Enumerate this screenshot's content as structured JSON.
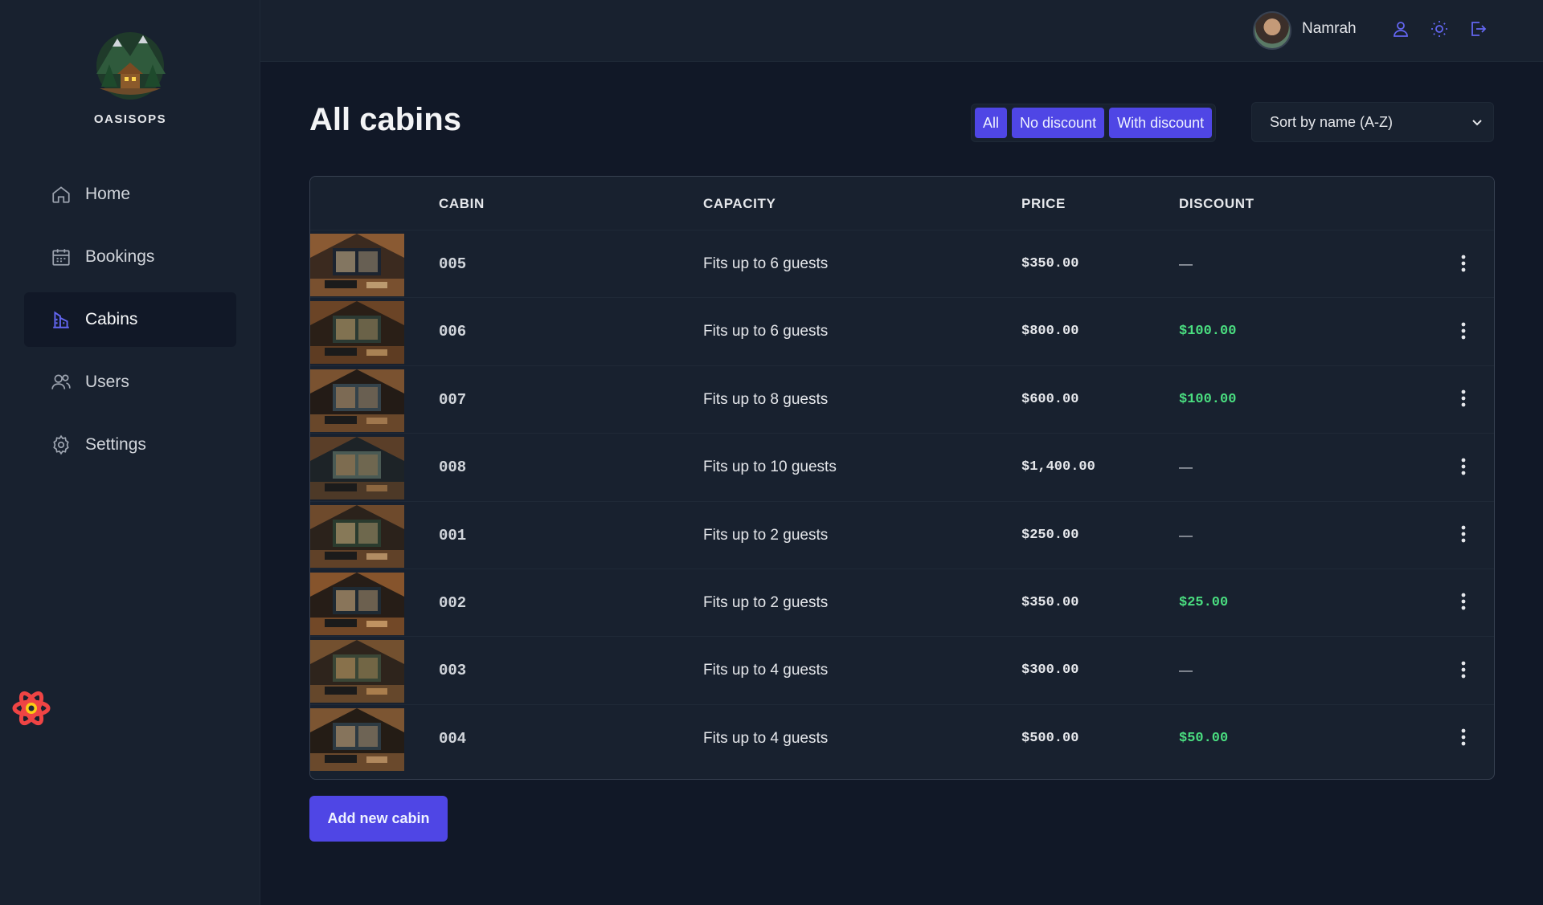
{
  "brand": {
    "name": "OASISOPS",
    "logo": "mountain-cabin-logo"
  },
  "sidebar": {
    "items": [
      {
        "label": "Home",
        "icon": "home-icon",
        "active": false
      },
      {
        "label": "Bookings",
        "icon": "calendar-icon",
        "active": false
      },
      {
        "label": "Cabins",
        "icon": "building-icon",
        "active": true
      },
      {
        "label": "Users",
        "icon": "users-icon",
        "active": false
      },
      {
        "label": "Settings",
        "icon": "gear-icon",
        "active": false
      }
    ]
  },
  "header": {
    "user_name": "Namrah",
    "icons": [
      "user-icon",
      "sun-icon",
      "logout-icon"
    ]
  },
  "main": {
    "title": "All cabins",
    "filter": {
      "options": [
        "All",
        "No discount",
        "With discount"
      ],
      "selected": "All"
    },
    "sort": {
      "selected": "Sort by name (A-Z)"
    }
  },
  "table": {
    "columns": [
      "",
      "CABIN",
      "CAPACITY",
      "PRICE",
      "DISCOUNT",
      ""
    ],
    "rows": [
      {
        "cabin": "005",
        "capacity": "Fits up to 6 guests",
        "price": "$350.00",
        "discount": "—"
      },
      {
        "cabin": "006",
        "capacity": "Fits up to 6 guests",
        "price": "$800.00",
        "discount": "$100.00"
      },
      {
        "cabin": "007",
        "capacity": "Fits up to 8 guests",
        "price": "$600.00",
        "discount": "$100.00"
      },
      {
        "cabin": "008",
        "capacity": "Fits up to 10 guests",
        "price": "$1,400.00",
        "discount": "—"
      },
      {
        "cabin": "001",
        "capacity": "Fits up to 2 guests",
        "price": "$250.00",
        "discount": "—"
      },
      {
        "cabin": "002",
        "capacity": "Fits up to 2 guests",
        "price": "$350.00",
        "discount": "$25.00"
      },
      {
        "cabin": "003",
        "capacity": "Fits up to 4 guests",
        "price": "$300.00",
        "discount": "—"
      },
      {
        "cabin": "004",
        "capacity": "Fits up to 4 guests",
        "price": "$500.00",
        "discount": "$50.00"
      }
    ]
  },
  "actions": {
    "add_label": "Add new cabin"
  },
  "colors": {
    "accent": "#4f46e5",
    "accent_icon": "#6366f1",
    "discount": "#4ade80",
    "background": "#111827",
    "panel": "#18212f"
  }
}
